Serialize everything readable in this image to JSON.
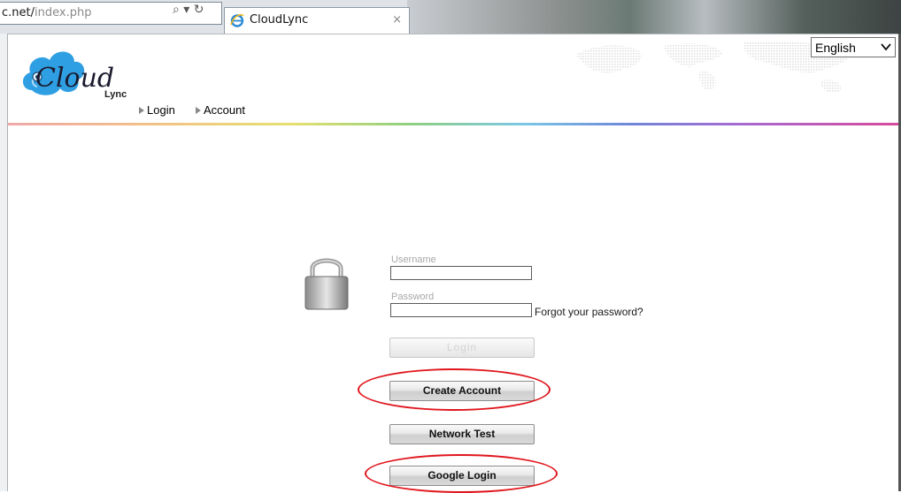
{
  "browser": {
    "address_dim": "c.net/",
    "address_text": "index.php",
    "addr_icons": "⌕ ▾ ↻",
    "tab_title": "CloudLync",
    "tab_close": "×"
  },
  "header": {
    "logo_text": "Cloud",
    "logo_sub": "Lync",
    "language": "English",
    "nav": [
      {
        "label": "Login"
      },
      {
        "label": "Account"
      }
    ]
  },
  "login": {
    "username_label": "Username",
    "username_value": "",
    "password_label": "Password",
    "password_value": "",
    "forgot_link": "Forgot your password?",
    "login_button": "Login",
    "create_account_button": "Create Account",
    "network_test_button": "Network Test",
    "google_login_button": "Google Login"
  },
  "colors": {
    "annotation": "#e0161d",
    "logo_cloud": "#2f9fe3"
  }
}
